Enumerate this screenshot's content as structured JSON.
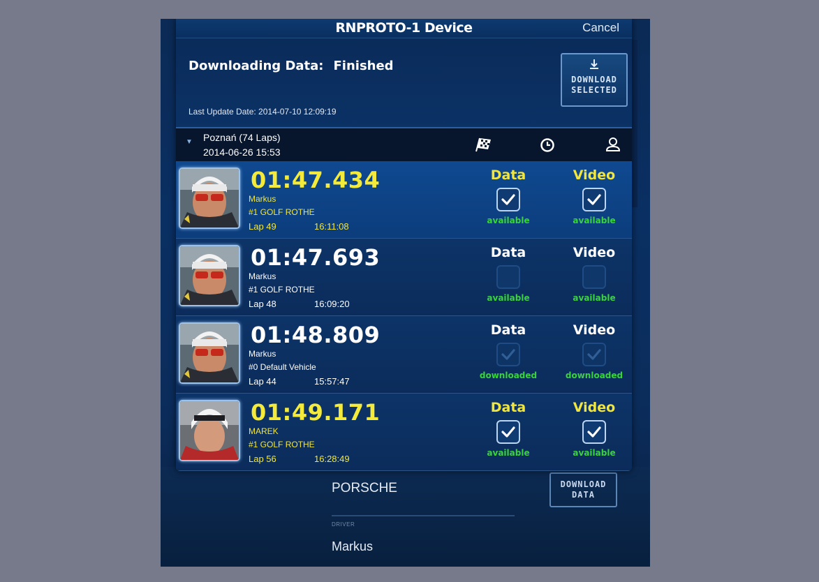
{
  "window": {
    "title": "RNPROTO-1 Device",
    "cancel_label": "Cancel"
  },
  "status": {
    "label": "Downloading Data:",
    "value": "Finished",
    "last_update": "Last Update Date: 2014-07-10 12:09:19"
  },
  "download_selected": {
    "icon": "download-arrow-icon",
    "label_line1": "DOWNLOAD",
    "label_line2": "SELECTED"
  },
  "track": {
    "name": "Poznań (74 Laps)",
    "date": "2014-06-26 15:53",
    "icons": [
      "checkered-flag-icon",
      "clock-icon",
      "user-icon"
    ]
  },
  "columns": {
    "data": "Data",
    "video": "Video"
  },
  "laps": [
    {
      "time": "01:47.434",
      "driver": "Markus",
      "vehicle": "#1 GOLF ROTHE",
      "lap": "Lap 49",
      "time_of_day": "16:11:08",
      "highlight": true,
      "data_checked": true,
      "video_checked": true,
      "data_status": "available",
      "video_status": "available"
    },
    {
      "time": "01:47.693",
      "driver": "Markus",
      "vehicle": "#1 GOLF ROTHE",
      "lap": "Lap 48",
      "time_of_day": "16:09:20",
      "highlight": false,
      "data_checked": false,
      "video_checked": false,
      "data_status": "available",
      "video_status": "available"
    },
    {
      "time": "01:48.809",
      "driver": "Markus",
      "vehicle": "#0 Default Vehicle",
      "lap": "Lap 44",
      "time_of_day": "15:57:47",
      "highlight": false,
      "data_checked": "dim",
      "video_checked": "dim",
      "data_status": "downloaded",
      "video_status": "downloaded"
    },
    {
      "time": "01:49.171",
      "driver": "MAREK",
      "vehicle": "#1 GOLF ROTHE",
      "lap": "Lap 56",
      "time_of_day": "16:28:49",
      "highlight": "yellow",
      "data_checked": true,
      "video_checked": true,
      "data_status": "available",
      "video_status": "available"
    }
  ],
  "background_form": {
    "vehicle": "PORSCHE",
    "driver_label": "DRIVER",
    "driver": "Markus",
    "download_line1": "DOWNLOAD",
    "download_line2": "DATA"
  },
  "colors": {
    "accent_yellow": "#f4ea3c",
    "status_green": "#39d43a",
    "page_bg": "#777a8a"
  }
}
